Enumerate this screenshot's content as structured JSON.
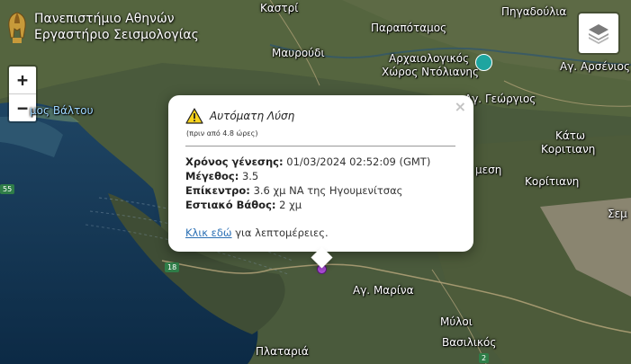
{
  "brand": {
    "line1": "Πανεπιστήμιο Αθηνών",
    "line2": "Εργαστήριο Σεισμολογίας",
    "logo_icon": "helmet-logo-icon"
  },
  "controls": {
    "zoom_in": "+",
    "zoom_out": "−",
    "layers_icon": "layers-icon"
  },
  "places": {
    "kastri": "Καστρί",
    "pigadoulia": "Πηγαδούλια",
    "paparotamos": "Παραπόταμος",
    "mavroudi": "Μαυρούδι",
    "arch_line1": "Αρχαιολογικός",
    "arch_line2": "Χώρος Ντόλιανης",
    "ag_arsenios": "Αγ. Αρσένιος",
    "limni_valtou": "μος Βάλτου",
    "ag_georgios": "Αγ. Γεώργιος",
    "kato_koritiani_1": "Κάτω",
    "kato_koritiani_2": "Κοριτιανη",
    "mesi": "μεση",
    "koritiani": "Κορίτιανη",
    "semi": "Σεμ",
    "ag_marina": "Αγ. Μαρίνα",
    "myloi": "Μύλοι",
    "vasilikos": "Βασιλικός",
    "platariá": "Πλαταριά"
  },
  "road_shields": {
    "r55": "55",
    "r18": "18",
    "r2": "2"
  },
  "popup": {
    "title": "Αυτόματη Λύση",
    "ago": "(πριν από 4.8 ώρες)",
    "origin_label": "Χρόνος γένεσης:",
    "origin_value": " 01/03/2024 02:52:09 (GMT)",
    "magnitude_label": "Μέγεθος:",
    "magnitude_value": " 3.5",
    "epicenter_label": "Επίκεντρο:",
    "epicenter_value": " 3.6 χμ ΝΑ της Ηγουμενίτσας",
    "depth_label": "Εστιακό Βάθος:",
    "depth_value": " 2 χμ",
    "link_text": "Κλικ εδώ",
    "link_suffix": " για λεπτομέρειες.",
    "close": "×"
  },
  "colors": {
    "marker": "#b24ee0",
    "sea_deep": "#0f2f4c",
    "land": "#44513a"
  }
}
